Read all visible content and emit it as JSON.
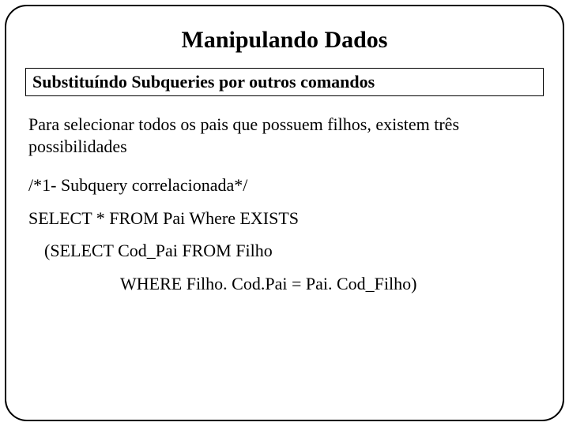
{
  "slide": {
    "title": "Manipulando Dados",
    "subtitle": "Substituíndo Subqueries por outros comandos",
    "intro": "Para selecionar todos os pais que possuem filhos, existem três possibilidades",
    "comment": "/*1- Subquery correlacionada*/",
    "sql_line1": "SELECT * FROM Pai Where EXISTS",
    "sql_line2": "(SELECT Cod_Pai FROM Filho",
    "sql_line3": "WHERE Filho. Cod.Pai = Pai. Cod_Filho)"
  }
}
